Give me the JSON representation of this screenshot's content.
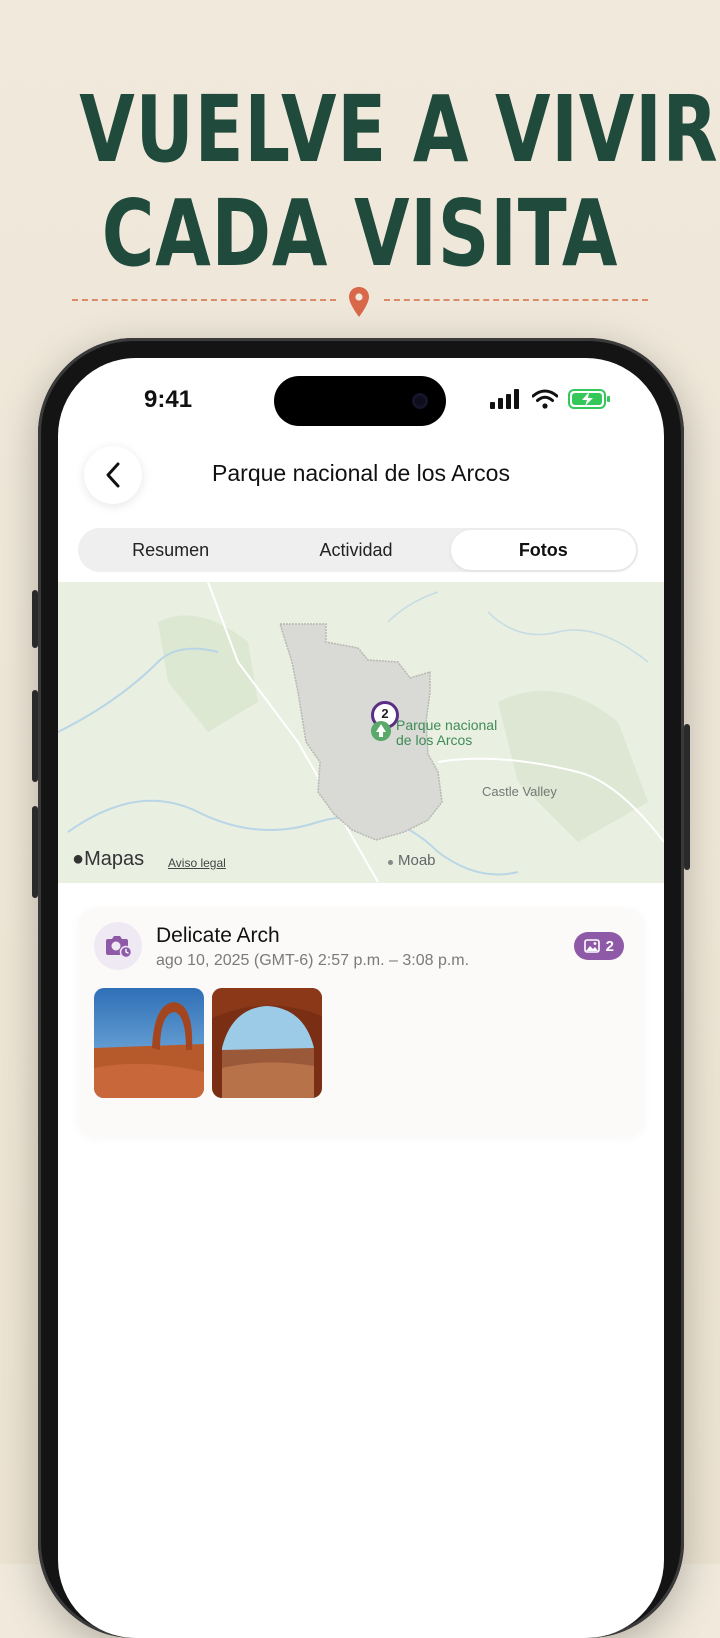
{
  "promo": {
    "headline_line1": "VUELVE A VIVIR",
    "headline_line2": "CADA VISITA"
  },
  "status_bar": {
    "time": "9:41"
  },
  "nav": {
    "title": "Parque nacional de los Arcos"
  },
  "tabs": [
    {
      "label": "Resumen",
      "selected": false
    },
    {
      "label": "Actividad",
      "selected": false
    },
    {
      "label": "Fotos",
      "selected": true
    }
  ],
  "map": {
    "park_label_line1": "Parque nacional",
    "park_label_line2": "de los Arcos",
    "cluster_count": "2",
    "place1": "Castle Valley",
    "place2": "Moab",
    "brand": "Mapas",
    "legal": "Aviso legal"
  },
  "visit": {
    "title": "Delicate Arch",
    "datetime": "ago 10, 2025 (GMT-6) 2:57 p.m. – 3:08 p.m.",
    "photo_count": "2",
    "photos": [
      "delicate-arch-photo",
      "arch-window-photo"
    ]
  },
  "colors": {
    "headline": "#1f4a3c",
    "accent_pin": "#d9684a",
    "badge": "#8e5aa8",
    "park_area": "#d9d9d5"
  }
}
